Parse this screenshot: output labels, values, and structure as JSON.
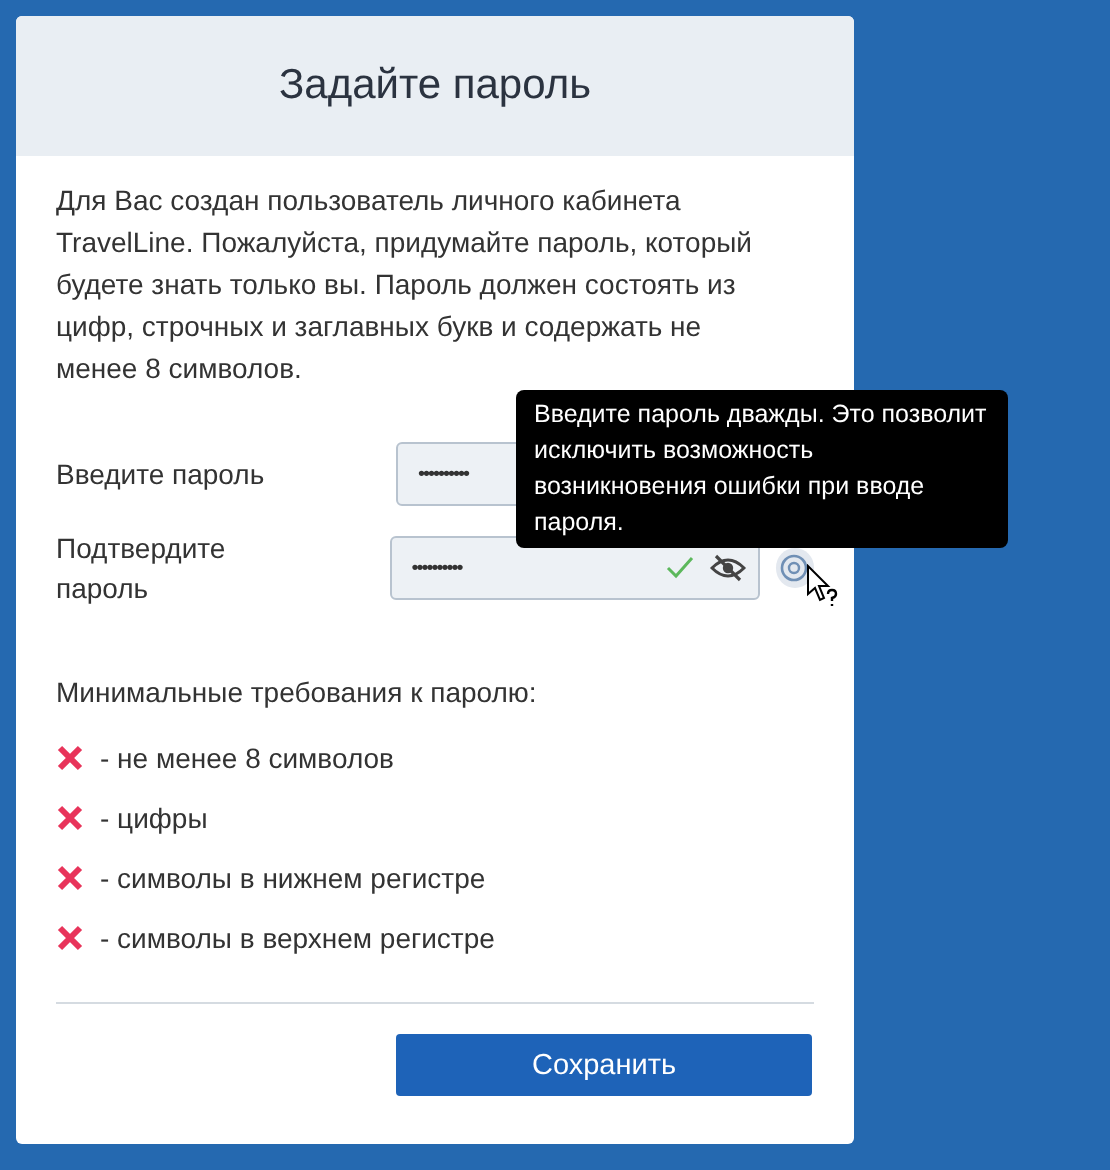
{
  "title": "Задайте пароль",
  "description": "Для Вас создан пользователь личного кабинета TravelLine. Пожалуйста, придумайте пароль, который будете знать только вы. Пароль должен состоять из цифр, строчных и заглавных букв и содержать не менее 8 символов.",
  "fields": [
    {
      "label": "Введите пароль",
      "value": "••••••••••"
    },
    {
      "label": "Подтвердите пароль",
      "value": "••••••••••",
      "valid": true,
      "reveal_toggle": true,
      "help": true
    }
  ],
  "tooltip": "Введите пароль дважды. Это позволит исключить возможность возникновения ошибки при вводе пароля.",
  "requirements_title": "Минимальные требования к паролю:",
  "requirements": [
    {
      "text": "- не менее 8 символов",
      "met": false
    },
    {
      "text": "- цифры",
      "met": false
    },
    {
      "text": "- символы в нижнем регистре",
      "met": false
    },
    {
      "text": "- символы в верхнем регистре",
      "met": false
    }
  ],
  "save_button": "Сохранить"
}
